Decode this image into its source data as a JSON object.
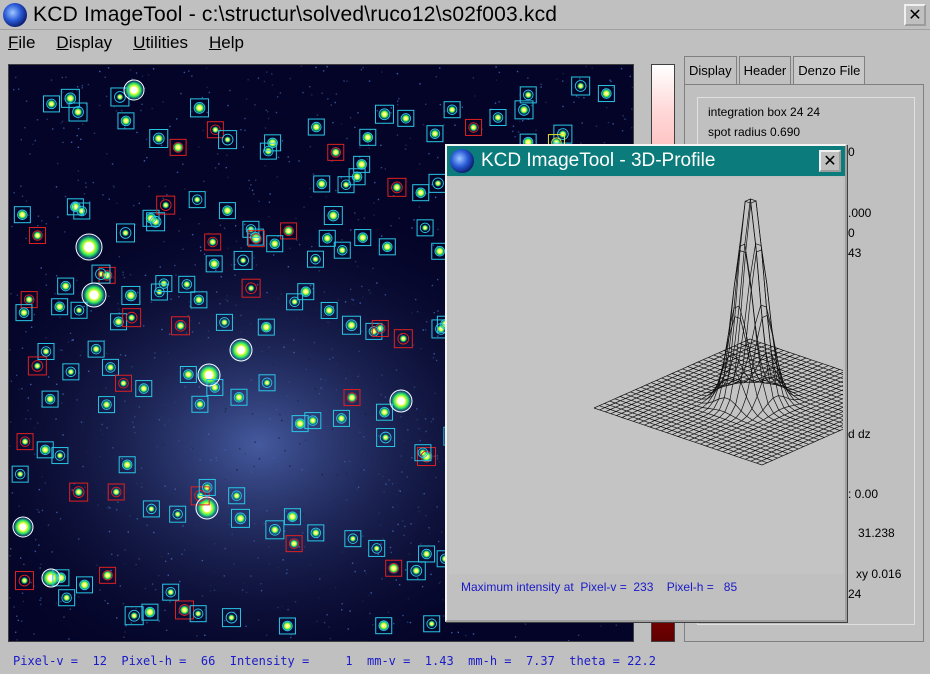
{
  "window": {
    "title": "KCD ImageTool - c:\\structur\\solved\\ruco12\\s02f003.kcd",
    "close_label": "✕"
  },
  "menu": [
    {
      "label": "File",
      "mnemonic": "F"
    },
    {
      "label": "Display",
      "mnemonic": "D"
    },
    {
      "label": "Utilities",
      "mnemonic": "U"
    },
    {
      "label": "Help",
      "mnemonic": "H"
    }
  ],
  "tabs": [
    {
      "label": "Display",
      "active": false
    },
    {
      "label": "Header",
      "active": false
    },
    {
      "label": "Denzo File",
      "active": true
    }
  ],
  "denzo_panel": {
    "integration_box": "integration box  24  24",
    "spot_radius": "spot radius 0.690",
    "fragment_1": "0",
    "fragment_2": ".000",
    "fragment_3": "0",
    "fragment_4": "43",
    "fragment_5": "d dz",
    "fragment_6": ":  0.00",
    "fragment_7": "31.238",
    "fragment_8": "xy  0.016",
    "fragment_9": "24"
  },
  "profile_dialog": {
    "title": "KCD ImageTool - 3D-Profile",
    "close_label": "✕",
    "status": "Maximum intensity at  Pixel-v =  233    Pixel-h =   85"
  },
  "status_bar": {
    "text": "Pixel-v =  12  Pixel-h =  66  Intensity =     1  mm-v =  1.43  mm-h =  7.37  theta = 22.2"
  },
  "colors": {
    "detector_background": "#040428",
    "predicted_box": "#29c6e6",
    "rejected_box": "#e02020",
    "overload_box": "#e6e629",
    "dialog_title": "#0c7b7b",
    "status_text": "#1a1ac8"
  },
  "icons": {
    "app": "kcd-app-icon",
    "close": "close-icon"
  }
}
